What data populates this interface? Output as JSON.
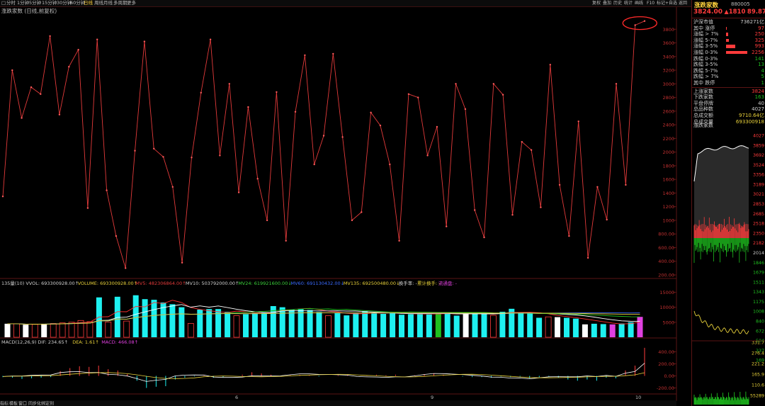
{
  "topbar": {
    "items": [
      "□",
      "分时",
      "1分钟",
      "5分钟",
      "15分钟",
      "30分钟",
      "60分钟",
      "日线",
      "周线",
      "月线",
      "多周期",
      "更多"
    ],
    "active_index": 7,
    "right_items": [
      "复权",
      "叠加",
      "历史",
      "统计",
      "画线",
      "F10",
      "标记",
      "+自选",
      "返回"
    ]
  },
  "main_title": "涨跌家数 (日线,前复权)",
  "colors": {
    "up": "#ff3b3b",
    "down": "#1fbf1f",
    "line": "#e23a3a",
    "cyan": "#1ef0f0",
    "yellow": "#e8d13a",
    "magenta": "#e040e0",
    "axis": "#5a1414"
  },
  "indicator_bar": [
    {
      "text": "135量(10) VVOL: 693300928.00↑",
      "color": "#cfcfcf"
    },
    {
      "text": "VOLUME: 693300928.00↑",
      "color": "#e8d13a"
    },
    {
      "text": "MV5: 482306864.00↑",
      "color": "#e23a3a"
    },
    {
      "text": "MV10: 503792000.00↑",
      "color": "#cfcfcf"
    },
    {
      "text": "MV24: 619921600.00↓",
      "color": "#3ad13a"
    },
    {
      "text": "MV60: 691130432.00↓",
      "color": "#3a6bff"
    },
    {
      "text": "MV135: 692500480.00↓",
      "color": "#e8d13a"
    },
    {
      "text": "换手率: -",
      "color": "#cfcfcf"
    },
    {
      "text": "累计换手: -",
      "color": "#e8d13a"
    },
    {
      "text": "流通盘: -",
      "color": "#e040e0"
    }
  ],
  "macd_bar": [
    {
      "text": "MACD(12,26,9) DIF: 234.65↑",
      "color": "#cfcfcf"
    },
    {
      "text": "DEA: 1.61↑",
      "color": "#e8d13a"
    },
    {
      "text": "MACD: 466.08↑",
      "color": "#e040e0"
    }
  ],
  "bottom_tabs": [
    "指标",
    "模板",
    "窗口",
    "同步化",
    "绑定到"
  ],
  "bottom_dates": [
    "6",
    "9",
    "10"
  ],
  "chart_data": [
    {
      "type": "line",
      "name": "涨跌家数",
      "y_ticks": [
        "3800",
        "3600",
        "3400",
        "3200",
        "3000",
        "2800",
        "2600",
        "2400",
        "2200",
        "2000",
        "1800",
        "1600",
        "1400",
        "1200",
        "1000",
        "800.00",
        "600.00",
        "400.00",
        "200.00"
      ],
      "ylim": [
        200,
        4000
      ],
      "values": [
        1350,
        3200,
        2500,
        2950,
        2850,
        3700,
        2550,
        3250,
        3500,
        1180,
        3650,
        1440,
        770,
        300,
        2020,
        3620,
        2050,
        1930,
        1490,
        380,
        1920,
        2870,
        3650,
        1950,
        3000,
        1410,
        2660,
        1610,
        1000,
        2880,
        700,
        2590,
        3420,
        1820,
        2240,
        3440,
        2220,
        1000,
        1120,
        2580,
        2390,
        1820,
        700,
        2850,
        2800,
        1950,
        2370,
        910,
        3000,
        2630,
        1150,
        750,
        3000,
        2840,
        1080,
        2150,
        2030,
        1190,
        3280,
        1520,
        770,
        2450,
        450,
        1490,
        1010,
        3000,
        1520,
        3860,
        3920
      ]
    },
    {
      "type": "bar",
      "name": "135量",
      "y_ticks": [
        "15000",
        "10000",
        "5000"
      ],
      "values": [
        4500,
        4500,
        4200,
        4300,
        4500,
        4600,
        4800,
        5000,
        5600,
        5200,
        13300,
        5100,
        13500,
        5400,
        14000,
        12700,
        12500,
        11600,
        11000,
        10000,
        4600,
        9200,
        9400,
        9400,
        8500,
        7200,
        7700,
        8100,
        8200,
        10400,
        10000,
        9200,
        9500,
        9100,
        8400,
        7200,
        8000,
        7300,
        8200,
        8700,
        8200,
        7800,
        8000,
        7500,
        7700,
        8000,
        7600,
        8200,
        7900,
        7200,
        8000,
        8300,
        7800,
        7300,
        8500,
        9500,
        8300,
        8100,
        6500,
        6800,
        6700,
        6500,
        6200,
        4300,
        4500,
        4400,
        4300,
        4600,
        5000,
        6800
      ],
      "bar_colors": [
        "w",
        "o",
        "w",
        "o",
        "w",
        "o",
        "o",
        "o",
        "o",
        "o",
        "c",
        "o",
        "c",
        "o",
        "c",
        "c",
        "c",
        "c",
        "c",
        "c",
        "o",
        "c",
        "c",
        "c",
        "c",
        "o",
        "c",
        "c",
        "c",
        "c",
        "c",
        "c",
        "c",
        "c",
        "c",
        "o",
        "c",
        "c",
        "c",
        "c",
        "c",
        "c",
        "c",
        "c",
        "c",
        "c",
        "c",
        "g",
        "c",
        "c",
        "w",
        "c",
        "c",
        "o",
        "c",
        "c",
        "c",
        "c",
        "c",
        "o",
        "w",
        "c",
        "c",
        "w",
        "c",
        "c",
        "m",
        "c",
        "c",
        "m",
        "c",
        "c",
        "c",
        "w",
        "c",
        "o",
        "o"
      ],
      "series_lines": [
        "MV5",
        "MV10",
        "MV24",
        "MV60",
        "MV135"
      ]
    },
    {
      "type": "bar",
      "name": "MACD",
      "y_ticks": [
        "400.00",
        "200.00",
        "0.00",
        "-200.00"
      ],
      "ylim": [
        -300,
        500
      ],
      "values": [
        -20,
        -30,
        -50,
        -40,
        -30,
        -20,
        80,
        130,
        160,
        150,
        170,
        110,
        90,
        30,
        -80,
        -200,
        -180,
        -170,
        -60,
        -30,
        -10,
        10,
        -30,
        -20,
        0,
        20,
        60,
        40,
        20,
        0,
        10,
        20,
        10,
        -10,
        0,
        10,
        20,
        0,
        10,
        20,
        10,
        20,
        0,
        10,
        30,
        40,
        20,
        0,
        -10,
        -20,
        -20,
        -30,
        -10,
        -20,
        -10,
        -40,
        -20,
        -10,
        -30,
        -60,
        -80,
        -60,
        -80,
        -30,
        -40,
        90,
        170,
        466
      ]
    }
  ],
  "right_panel": {
    "title": "涨跌家数",
    "code": "880005",
    "price": "3824.00",
    "arrow": "▲",
    "change": "1810",
    "change_pct": "89.87%",
    "rows": [
      {
        "label": "沪深市值",
        "value": "736271亿",
        "color": "#cfcfcf",
        "bar": 0
      },
      {
        "label": "其中 涨停",
        "value": "97",
        "color": "#ff3b3b",
        "bar": 0.03
      },
      {
        "label": "涨幅 > 7%",
        "value": "250",
        "color": "#ff3b3b",
        "bar": 0.11
      },
      {
        "label": "涨幅 5-7%",
        "value": "325",
        "color": "#ff3b3b",
        "bar": 0.14
      },
      {
        "label": "涨幅 3-5%",
        "value": "993",
        "color": "#ff3b3b",
        "bar": 0.44
      },
      {
        "label": "涨幅 0-3%",
        "value": "2256",
        "color": "#ff3b3b",
        "bar": 1.0
      },
      {
        "label": "跌幅 0-3%",
        "value": "141",
        "color": "#1fbf1f",
        "bar": 0
      },
      {
        "label": "跌幅 3-5%",
        "value": "13",
        "color": "#1fbf1f",
        "bar": 0
      },
      {
        "label": "跌幅 5-7%",
        "value": "4",
        "color": "#1fbf1f",
        "bar": 0
      },
      {
        "label": "跌幅 > 7%",
        "value": "5",
        "color": "#1fbf1f",
        "bar": 0
      },
      {
        "label": "其中 跌停",
        "value": "1",
        "color": "#1fbf1f",
        "bar": 0
      },
      {
        "label": "上涨家数",
        "value": "3824",
        "color": "#ff3b3b",
        "bar": 0
      },
      {
        "label": "下跌家数",
        "value": "163",
        "color": "#1fbf1f",
        "bar": 0
      },
      {
        "label": "平盘停牌",
        "value": "40",
        "color": "#cfcfcf",
        "bar": 0
      },
      {
        "label": "总品种数",
        "value": "4027",
        "color": "#cfcfcf",
        "bar": 0
      },
      {
        "label": "总成交额",
        "value": "9710.64亿",
        "color": "#e8d13a",
        "bar": 0
      },
      {
        "label": "总成交量",
        "value": "693300918",
        "color": "#e8d13a",
        "bar": 0
      }
    ],
    "counts_label": "涨跌家数",
    "mini_ticks": [
      "4027",
      "3859",
      "3692",
      "3524",
      "3356",
      "3189",
      "3021",
      "2853",
      "2685",
      "2518",
      "2350",
      "2182",
      "2014",
      "1846",
      "1679",
      "1511",
      "1343",
      "1175",
      "1008",
      "840",
      "672",
      "504",
      "337",
      "169",
      "331.7",
      "276.4",
      "221.2",
      "165.9",
      "110.6",
      "55289"
    ],
    "mini_bottom_label": "日线"
  }
}
